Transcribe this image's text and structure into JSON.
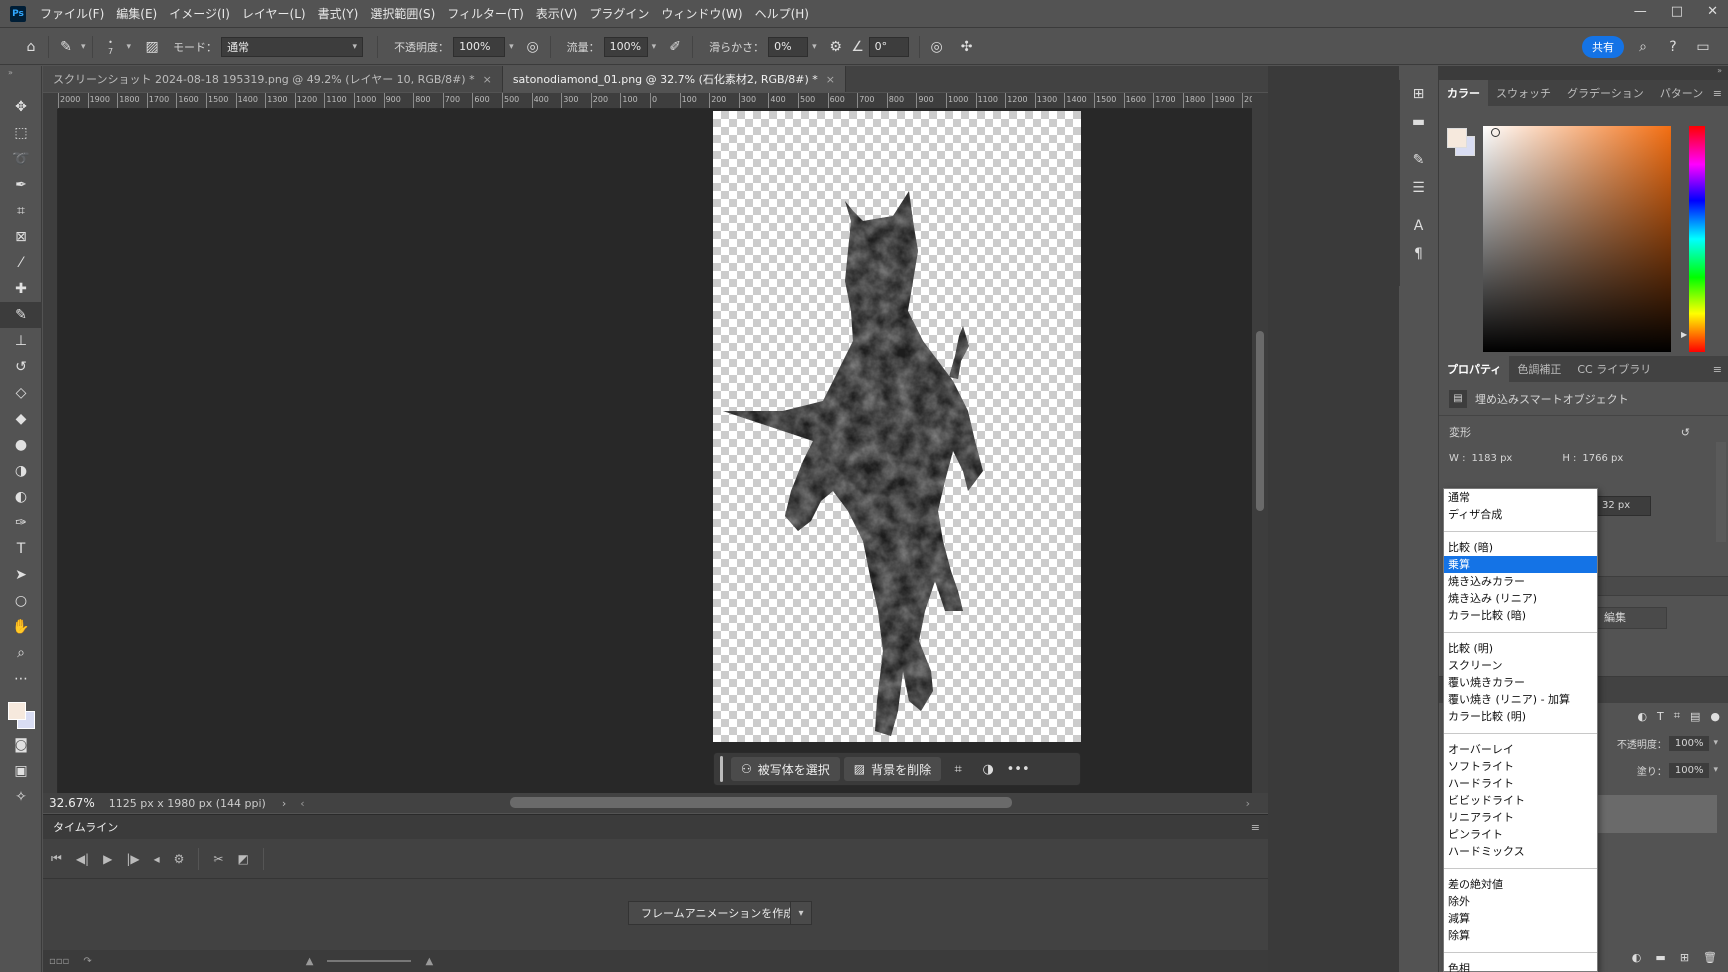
{
  "app": {
    "logo": "Ps"
  },
  "menu": [
    "ファイル(F)",
    "編集(E)",
    "イメージ(I)",
    "レイヤー(L)",
    "書式(Y)",
    "選択範囲(S)",
    "フィルター(T)",
    "表示(V)",
    "プラグイン",
    "ウィンドウ(W)",
    "ヘルプ(H)"
  ],
  "window_controls": {
    "minimize": "—",
    "maximize": "□",
    "close": "✕"
  },
  "options": {
    "brush_size": "7",
    "mode_label": "モード：",
    "mode_value": "通常",
    "opacity_label": "不透明度：",
    "opacity_value": "100%",
    "flow_label": "流量：",
    "flow_value": "100%",
    "smoothing_label": "滑らかさ：",
    "smoothing_value": "0%",
    "angle_value": "0°",
    "share_label": "共有"
  },
  "tabs": [
    {
      "label": "スクリーンショット 2024-08-18 195319.png @ 49.2% (レイヤー 10, RGB/8#) *",
      "active": false
    },
    {
      "label": "satonodiamond_01.png @ 32.7% (石化素材2, RGB/8#) *",
      "active": true
    }
  ],
  "ruler": [
    "2000",
    "1900",
    "1800",
    "1700",
    "1600",
    "1500",
    "1400",
    "1300",
    "1200",
    "1100",
    "1000",
    "900",
    "800",
    "700",
    "600",
    "500",
    "400",
    "300",
    "200",
    "100",
    "0",
    "100",
    "200",
    "300",
    "400",
    "500",
    "600",
    "700",
    "800",
    "900",
    "1000",
    "1100",
    "1200",
    "1300",
    "1400",
    "1500",
    "1600",
    "1700",
    "1800",
    "1900",
    "20"
  ],
  "status": {
    "zoom": "32.67%",
    "doc_info": "1125 px x 1980 px (144 ppi)"
  },
  "taskbar": {
    "select_subject": "被写体を選択",
    "remove_bg": "背景を削除",
    "more": "•••"
  },
  "timeline": {
    "title": "タイムライン",
    "create_button": "フレームアニメーションを作成"
  },
  "color_panel": {
    "tabs": [
      "カラー",
      "スウォッチ",
      "グラデーション",
      "パターン"
    ],
    "fg": "#f6e9dd",
    "bg": "#d9ddf3"
  },
  "properties_panel": {
    "tabs": [
      "プロパティ",
      "色調補正",
      "CC ライブラリ"
    ],
    "object_type": "埋め込みスマートオブジェクト",
    "transform_label": "変形",
    "w_label": "W :",
    "w_value": "1183 px",
    "h_label": "H :",
    "h_value": "1766 px",
    "y_partial": "32 px",
    "edit_partial": "編集"
  },
  "layers_panel": {
    "opacity_label": "不透明度：",
    "opacity_value": "100%",
    "fill_label": "塗り：",
    "fill_value": "100%"
  },
  "blend_modes": {
    "groups": [
      [
        "通常",
        "ディザ合成"
      ],
      [
        "比較 (暗)",
        "乗算",
        "焼き込みカラー",
        "焼き込み (リニア)",
        "カラー比較 (暗)"
      ],
      [
        "比較 (明)",
        "スクリーン",
        "覆い焼きカラー",
        "覆い焼き (リニア) - 加算",
        "カラー比較 (明)"
      ],
      [
        "オーバーレイ",
        "ソフトライト",
        "ハードライト",
        "ビビッドライト",
        "リニアライト",
        "ピンライト",
        "ハードミックス"
      ],
      [
        "差の絶対値",
        "除外",
        "減算",
        "除算"
      ],
      [
        "色相"
      ]
    ],
    "selected": "乗算"
  }
}
